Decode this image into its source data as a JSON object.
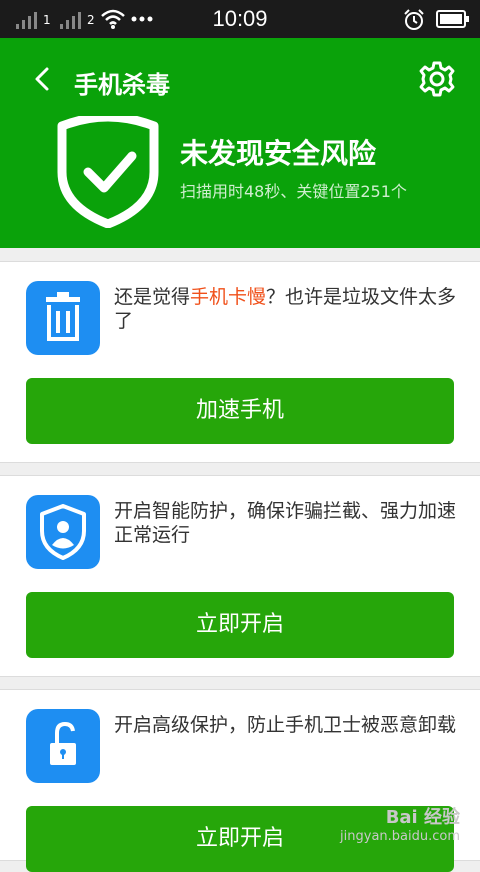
{
  "status_bar": {
    "sim1": "1",
    "sim2": "2",
    "time": "10:09"
  },
  "header": {
    "title": "手机杀毒",
    "result_title": "未发现安全风险",
    "result_sub": "扫描用时48秒、关键位置251个"
  },
  "cards": [
    {
      "text_before": "还是觉得",
      "highlight": "手机卡慢",
      "text_after": "？也许是垃圾文件太多了",
      "button": "加速手机",
      "icon": "trash-icon"
    },
    {
      "text": "开启智能防护，确保诈骗拦截、强力加速正常运行",
      "button": "立即开启",
      "icon": "shield-person-icon"
    },
    {
      "text": "开启高级保护，防止手机卫士被恶意卸载",
      "button": "立即开启",
      "icon": "unlock-icon"
    }
  ],
  "watermark": {
    "brand": "Bai 经验",
    "url": "jingyan.baidu.com"
  },
  "colors": {
    "header_green": "#0aa20a",
    "button_green": "#26a60a",
    "icon_blue": "#1e8ef2",
    "highlight_orange": "#f0501a"
  }
}
